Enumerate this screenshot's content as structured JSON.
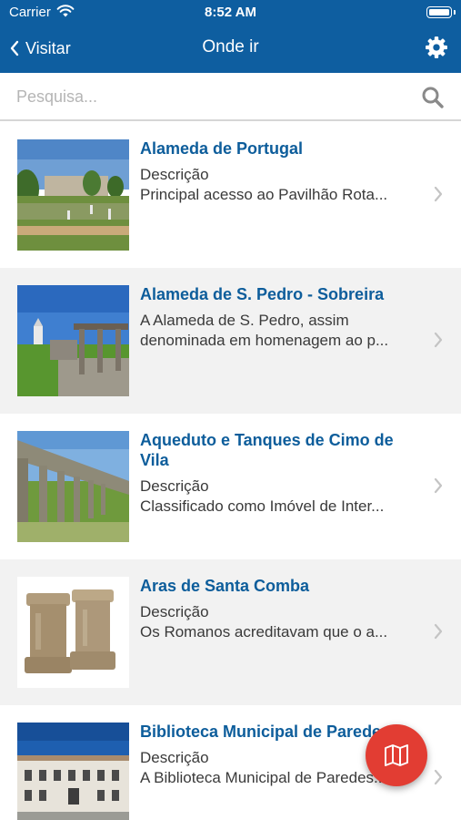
{
  "status_bar": {
    "carrier": "Carrier",
    "time": "8:52 AM"
  },
  "nav": {
    "back_label": "Visitar",
    "title": "Onde ir"
  },
  "search": {
    "placeholder": "Pesquisa..."
  },
  "places": [
    {
      "title": "Alameda de Portugal",
      "line1": "Descrição",
      "line2": "Principal acesso ao Pavilhão Rota..."
    },
    {
      "title": "Alameda de S. Pedro - Sobreira",
      "line1": "A Alameda de S. Pedro, assim",
      "line2": "denominada em homenagem ao p..."
    },
    {
      "title": "Aqueduto e Tanques de Cimo de Vila",
      "line1": "Descrição",
      "line2": "Classificado como Imóvel de Inter..."
    },
    {
      "title": "Aras de Santa Comba",
      "line1": "Descrição",
      "line2": "Os Romanos acreditavam que o a..."
    },
    {
      "title": "Biblioteca Municipal de Paredes",
      "line1": "Descrição",
      "line2": "A Biblioteca Municipal de Paredes..."
    }
  ],
  "colors": {
    "nav": "#0e5ea0",
    "title": "#0d5d9b",
    "fab": "#e23d33",
    "row_alt": "#f2f2f2"
  },
  "icons": {
    "back": "chevron-left-icon",
    "settings": "gear-icon",
    "search": "search-icon",
    "disclosure": "chevron-right-icon",
    "map": "map-icon"
  }
}
